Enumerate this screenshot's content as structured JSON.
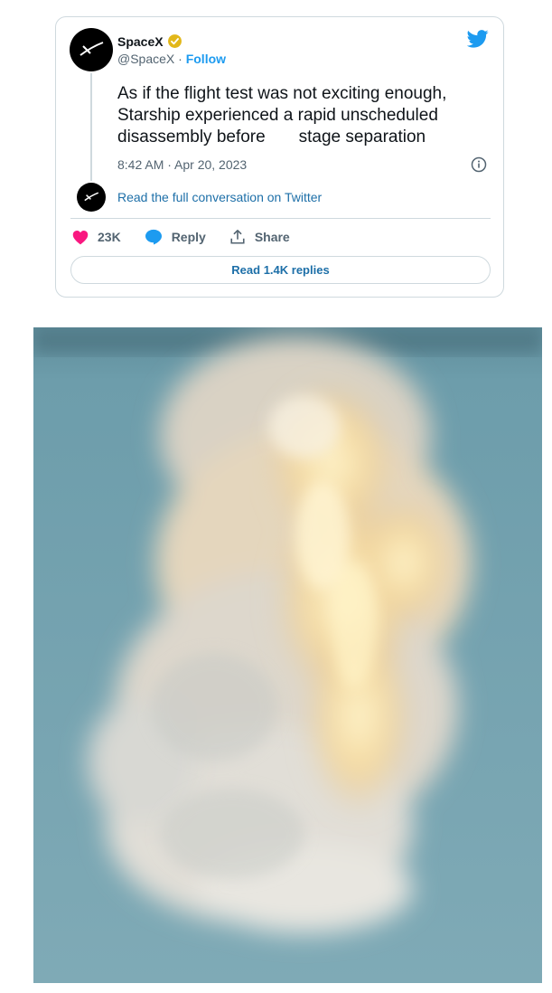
{
  "tweet": {
    "display_name": "SpaceX",
    "handle": "@SpaceX",
    "separator": "·",
    "follow_label": "Follow",
    "text": "As if the flight test was not exciting enough, Starship experienced a rapid unscheduled disassembly before       stage separation",
    "timestamp": "8:42 AM · Apr 20, 2023",
    "read_conversation_label": "Read the full conversation on Twitter",
    "likes_count": "23K",
    "reply_label": "Reply",
    "share_label": "Share",
    "read_replies_label": "Read 1.4K replies"
  },
  "colors": {
    "accent": "#1d9bf0",
    "verified_badge": "#e2b719",
    "heart": "#f91880",
    "sky": "#78a6b3"
  },
  "icons": [
    "spacex-logo-icon",
    "verified-badge-icon",
    "twitter-bird-icon",
    "info-icon",
    "heart-icon",
    "reply-bubble-icon",
    "share-icon"
  ]
}
